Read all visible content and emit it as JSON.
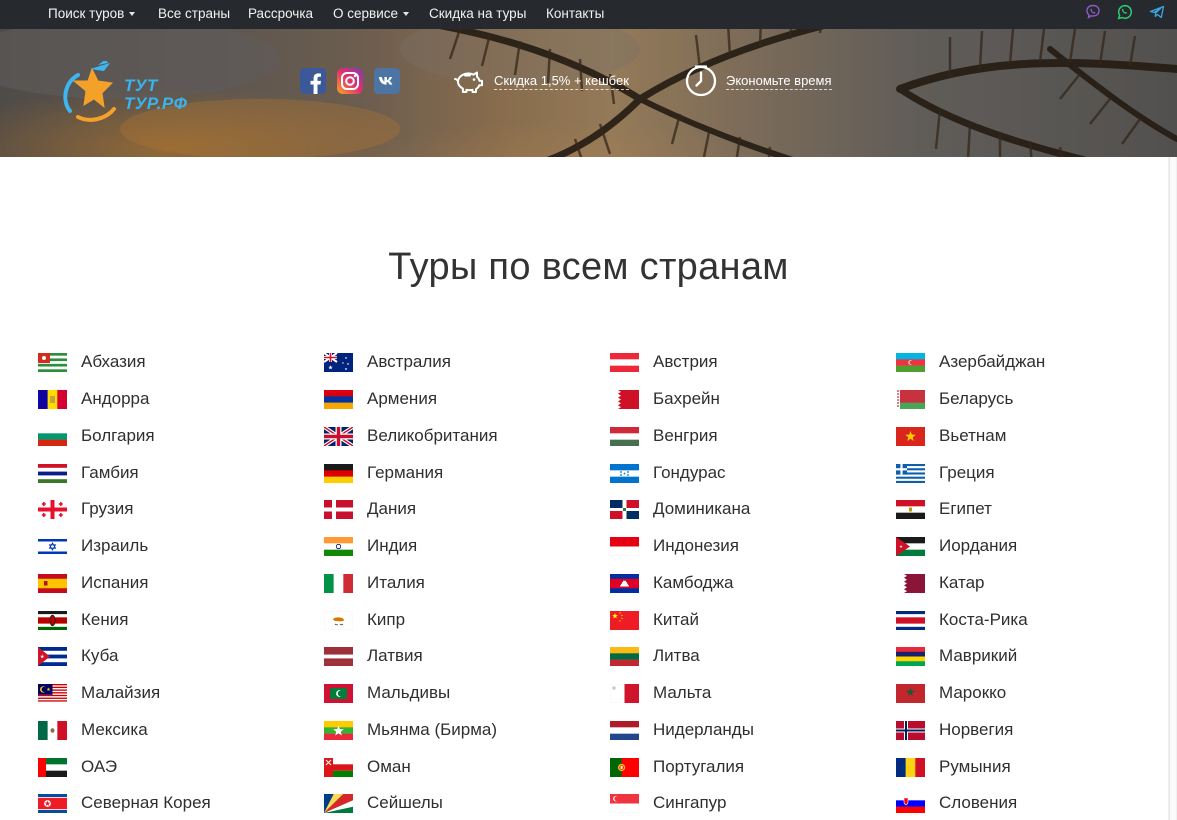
{
  "nav": {
    "items": [
      {
        "label": "Поиск туров",
        "dropdown": true
      },
      {
        "label": "Все страны",
        "dropdown": false
      },
      {
        "label": "Рассрочка",
        "dropdown": false
      },
      {
        "label": "О сервисе",
        "dropdown": true
      },
      {
        "label": "Скидка на туры",
        "dropdown": false
      },
      {
        "label": "Контакты",
        "dropdown": false
      }
    ],
    "messengers": [
      "viber-icon",
      "whatsapp-icon",
      "telegram-icon"
    ],
    "colors": {
      "bar": "#262a2e",
      "viber": "#7b519d",
      "whatsapp": "#25d366",
      "telegram": "#2ca5e0"
    }
  },
  "header": {
    "logo": {
      "line1": "ТУТ",
      "line2": "ТУР.РФ"
    },
    "social": [
      "facebook-icon",
      "instagram-icon",
      "vk-icon"
    ],
    "features": [
      {
        "icon": "piggy-bank-icon",
        "text": "Скидка 1,5% + кешбек"
      },
      {
        "icon": "clock-icon",
        "text": "Экономьте время"
      }
    ]
  },
  "main": {
    "title": "Туры по всем странам",
    "countries": [
      "Абхазия",
      "Австралия",
      "Австрия",
      "Азербайджан",
      "Андорра",
      "Армения",
      "Бахрейн",
      "Беларусь",
      "Болгария",
      "Великобритания",
      "Венгрия",
      "Вьетнам",
      "Гамбия",
      "Германия",
      "Гондурас",
      "Греция",
      "Грузия",
      "Дания",
      "Доминикана",
      "Египет",
      "Израиль",
      "Индия",
      "Индонезия",
      "Иордания",
      "Испания",
      "Италия",
      "Камбоджа",
      "Катар",
      "Кения",
      "Кипр",
      "Китай",
      "Коста-Рика",
      "Куба",
      "Латвия",
      "Литва",
      "Маврикий",
      "Малайзия",
      "Мальдивы",
      "Мальта",
      "Марокко",
      "Мексика",
      "Мьянма (Бирма)",
      "Нидерланды",
      "Норвегия",
      "ОАЭ",
      "Оман",
      "Португалия",
      "Румыния",
      "Северная Корея",
      "Сейшелы",
      "Сингапур",
      "Словения"
    ]
  }
}
